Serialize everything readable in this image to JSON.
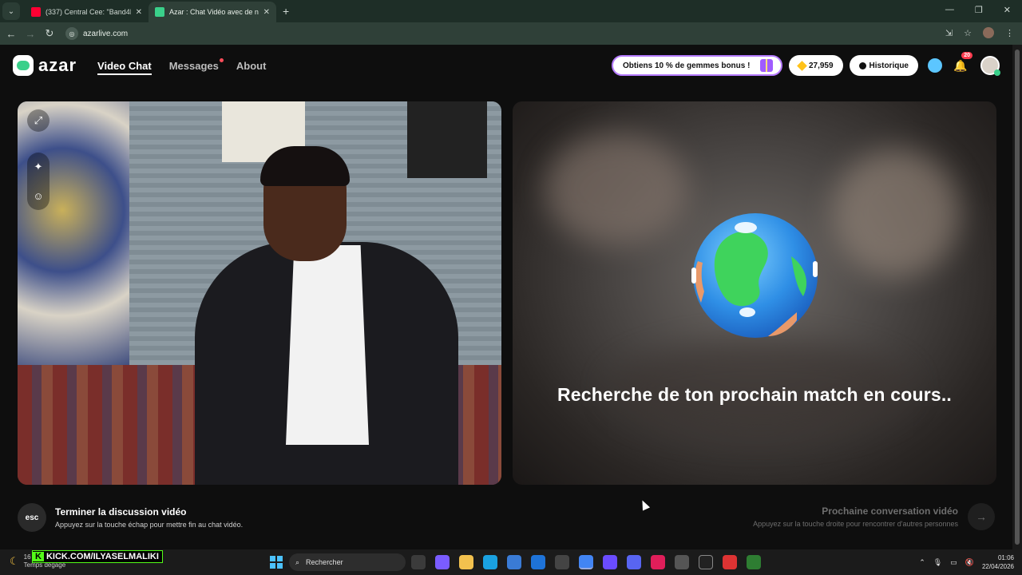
{
  "browser": {
    "tabs": [
      {
        "title": "(337) Central Cee: \"Band4Band",
        "favicon_color": "#ff0033"
      },
      {
        "title": "Azar : Chat Vidéo avec de n",
        "favicon_color": "#3ad08a",
        "active": true
      }
    ],
    "new_tab_icon": "plus-icon",
    "url": "azarlive.com"
  },
  "nav": {
    "logo_text": "azar",
    "links": {
      "video_chat": "Video Chat",
      "messages": "Messages",
      "about": "About"
    },
    "promo_label": "Obtiens 10 % de gemmes bonus !",
    "gems_count": "27,959",
    "history_label": "Historique",
    "notification_count": "20"
  },
  "main": {
    "searching_text": "Recherche de ton prochain match en cours..",
    "end_call": {
      "key_label": "esc",
      "title": "Terminer la discussion vidéo",
      "subtitle": "Appuyez sur la touche échap pour mettre fin au chat vidéo."
    },
    "next_call": {
      "title": "Prochaine conversation vidéo",
      "subtitle": "Appuyez sur la touche droite pour rencontrer d'autres personnes"
    }
  },
  "taskbar": {
    "weather_temp": "16",
    "weather_label": "Temps dégagé",
    "overlay_text": "KICK.COM/ILYASELMALIKI",
    "search_placeholder": "Rechercher",
    "time": "01:06",
    "date": "22/04/2026"
  }
}
